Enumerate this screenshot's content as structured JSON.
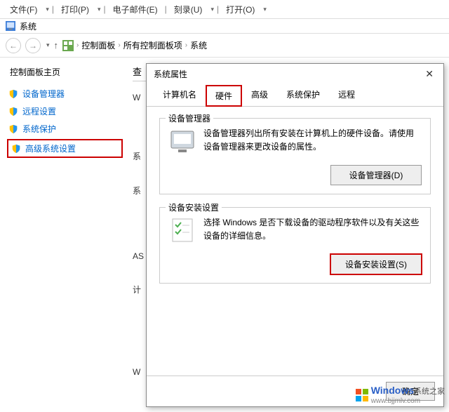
{
  "menubar": {
    "items": [
      "文件(F)",
      "打印(P)",
      "电子邮件(E)",
      "刻录(U)",
      "打开(O)"
    ]
  },
  "titlebar": {
    "text": "系统"
  },
  "breadcrumb": {
    "items": [
      "控制面板",
      "所有控制面板项",
      "系统"
    ]
  },
  "sidebar": {
    "heading": "控制面板主页",
    "items": [
      {
        "label": "设备管理器"
      },
      {
        "label": "远程设置"
      },
      {
        "label": "系统保护"
      },
      {
        "label": "高级系统设置",
        "highlighted": true
      }
    ]
  },
  "main": {
    "heading": "查",
    "labels": [
      "W",
      "系",
      "系",
      "AS",
      "计",
      "W"
    ]
  },
  "dialog": {
    "title": "系统属性",
    "tabs": [
      "计算机名",
      "硬件",
      "高级",
      "系统保护",
      "远程"
    ],
    "active_tab": "硬件",
    "group1": {
      "label": "设备管理器",
      "text": "设备管理器列出所有安装在计算机上的硬件设备。请使用设备管理器来更改设备的属性。",
      "button": "设备管理器(D)"
    },
    "group2": {
      "label": "设备安装设置",
      "text": "选择 Windows 是否下载设备的驱动程序软件以及有关这些设备的详细信息。",
      "button": "设备安装设置(S)"
    },
    "footer": {
      "ok": "确定"
    }
  },
  "watermark": {
    "brand": "Windows",
    "suffix": "系统之家",
    "url": "www.bjjmlv.com"
  }
}
